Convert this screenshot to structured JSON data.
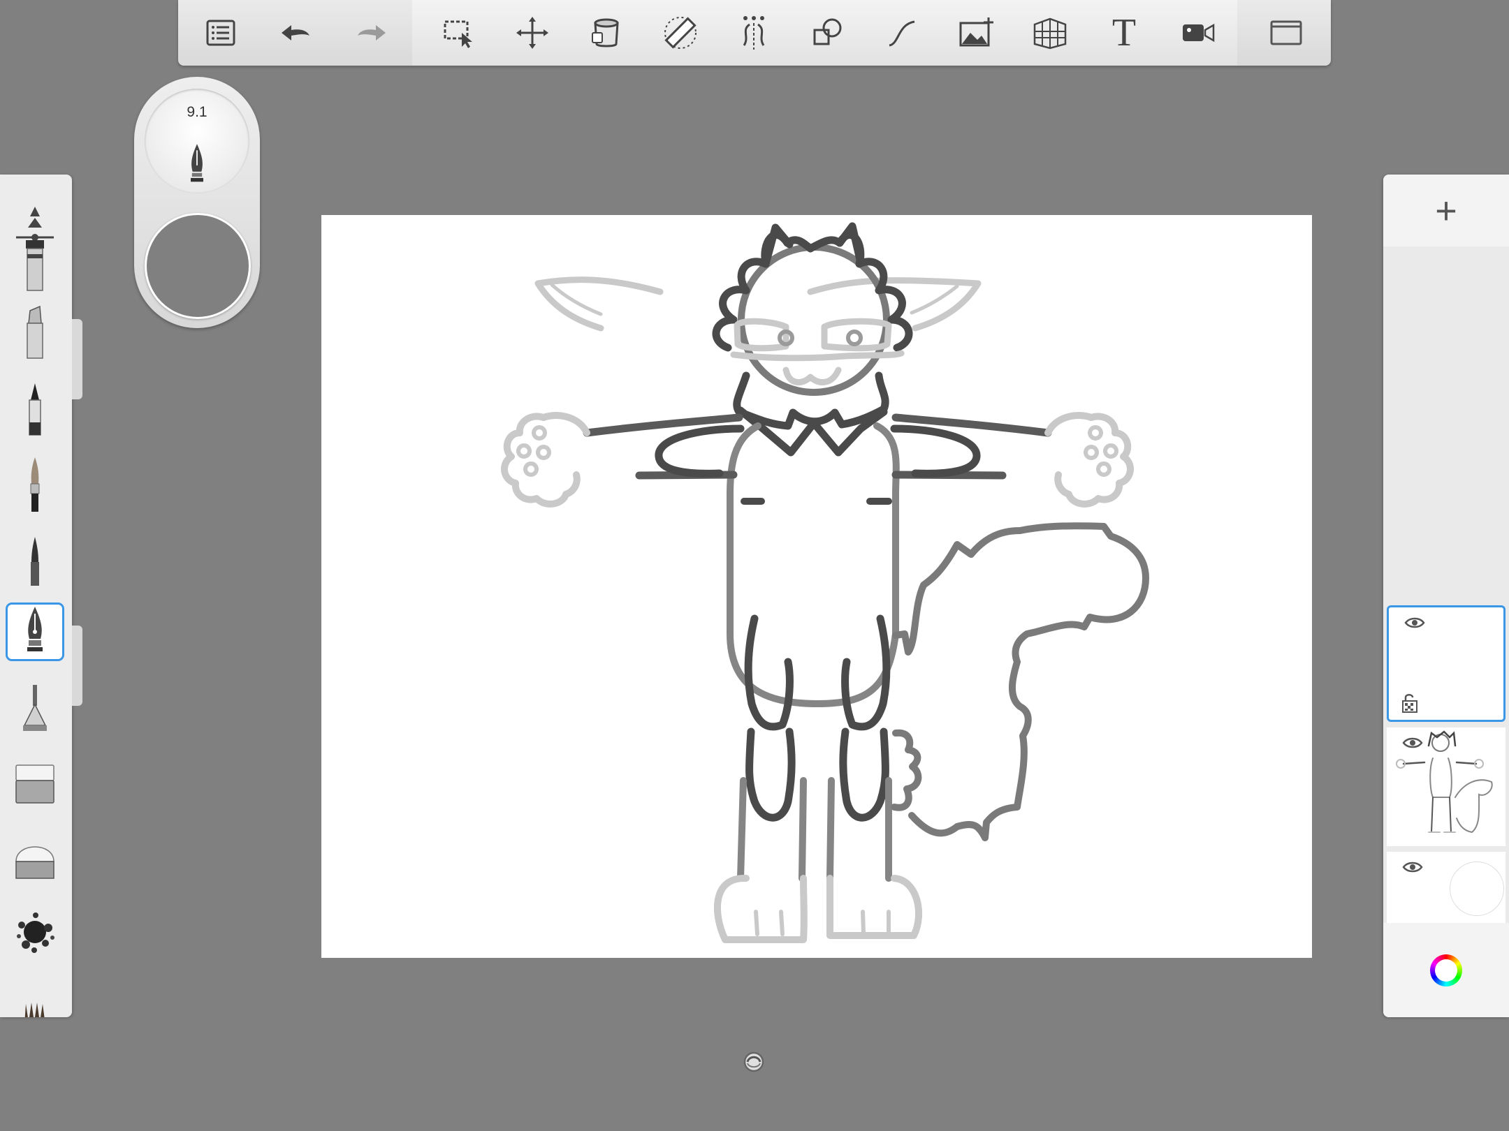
{
  "toolbar": {
    "buttons": [
      {
        "name": "layers-list-icon"
      },
      {
        "name": "undo-icon"
      },
      {
        "name": "redo-icon"
      },
      {
        "name": "selection-icon"
      },
      {
        "name": "transform-icon"
      },
      {
        "name": "fill-bucket-icon"
      },
      {
        "name": "ruler-icon"
      },
      {
        "name": "symmetry-icon"
      },
      {
        "name": "shapes-icon"
      },
      {
        "name": "curve-icon"
      },
      {
        "name": "add-image-icon"
      },
      {
        "name": "perspective-icon"
      },
      {
        "name": "text-icon"
      },
      {
        "name": "time-lapse-icon"
      },
      {
        "name": "fullscreen-icon"
      }
    ],
    "text_tool_glyph": "T"
  },
  "brush_puck": {
    "size_value": "9.1",
    "current_color": "#808080"
  },
  "brushes": {
    "items": [
      "marker",
      "chisel-marker",
      "pen",
      "paint-brush",
      "fine-brush",
      "ink-pen",
      "airbrush",
      "soft-eraser",
      "hard-eraser",
      "splatter",
      "bristle-brush"
    ],
    "selected": "ink-pen"
  },
  "layers": {
    "add_label": "+",
    "items": [
      {
        "name": "empty-layer",
        "selected": true,
        "visible": true
      },
      {
        "name": "drawing-layer",
        "selected": false,
        "visible": true
      },
      {
        "name": "background-layer",
        "selected": false,
        "visible": true
      }
    ]
  },
  "colors": {
    "accent": "#3a96e6",
    "background": "#808080",
    "canvas": "#ffffff"
  }
}
